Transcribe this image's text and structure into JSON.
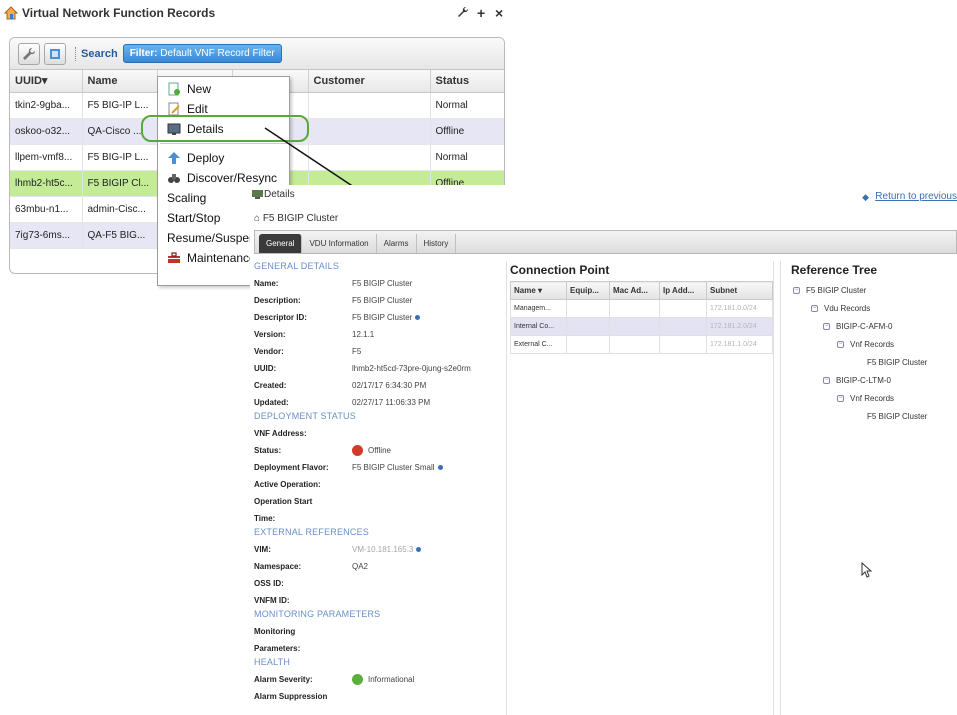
{
  "vnf_window": {
    "title": "Virtual Network Function Records",
    "controls": {
      "wrench": "wrench-icon",
      "plus": "+",
      "close": "×"
    },
    "toolbar": {
      "search_label": "Search",
      "filter_prefix": "Filter:",
      "filter_value": "Default VNF Record Filter"
    },
    "columns": [
      "UUID▾",
      "Name",
      "",
      "",
      "Customer",
      "Status"
    ],
    "rows": [
      {
        "uuid": "tkin2-9gba...",
        "name": "F5 BIG-IP L...",
        "customer": "",
        "status": "Normal"
      },
      {
        "uuid": "oskoo-o32...",
        "name": "QA-Cisco ...",
        "customer": "",
        "status": "Offline"
      },
      {
        "uuid": "llpem-vmf8...",
        "name": "F5 BIG-IP L...",
        "customer": "",
        "status": "Normal"
      },
      {
        "uuid": "lhmb2-ht5c...",
        "name": "F5 BIGIP Cl...",
        "customer": "",
        "status": "Offline"
      },
      {
        "uuid": "63mbu-n1...",
        "name": "admin-Cisc...",
        "customer": "",
        "status": ""
      },
      {
        "uuid": "7ig73-6ms...",
        "name": "QA-F5 BIG...",
        "customer": "",
        "status": ""
      }
    ]
  },
  "context_menu": {
    "items": [
      "New",
      "Edit",
      "Details",
      "Deploy",
      "Discover/Resync",
      "Scaling",
      "Start/Stop",
      "Resume/Suspend",
      "Maintenance"
    ]
  },
  "details": {
    "window_title": "Details",
    "return_link": "Return to previous",
    "subtitle": "F5 BIGIP Cluster",
    "tabs": [
      "General",
      "VDU Information",
      "Alarms",
      "History"
    ],
    "general": {
      "sections": [
        {
          "heading": "GENERAL DETAILS",
          "fields": [
            {
              "k": "Name:",
              "v": "F5 BIGIP Cluster"
            },
            {
              "k": "Description:",
              "v": "F5 BIGIP Cluster"
            },
            {
              "k": "Descriptor ID:",
              "v": "F5 BIGIP Cluster"
            },
            {
              "k": "Version:",
              "v": "12.1.1"
            },
            {
              "k": "Vendor:",
              "v": "F5"
            },
            {
              "k": "UUID:",
              "v": "lhmb2-ht5cd-73pre-0jung-s2e0rm"
            },
            {
              "k": "Created:",
              "v": "02/17/17 6:34:30 PM"
            },
            {
              "k": "Updated:",
              "v": "02/27/17 11:06:33 PM"
            }
          ]
        },
        {
          "heading": "DEPLOYMENT STATUS",
          "fields": [
            {
              "k": "VNF Address:",
              "v": ""
            },
            {
              "k": "Status:",
              "v": "Offline"
            },
            {
              "k": "Deployment Flavor:",
              "v": "F5 BIGIP Cluster Small"
            },
            {
              "k": "Active Operation:",
              "v": ""
            },
            {
              "k": "Operation Start",
              "v": ""
            },
            {
              "k": "Time:",
              "v": ""
            }
          ]
        },
        {
          "heading": "EXTERNAL REFERENCES",
          "fields": [
            {
              "k": "VIM:",
              "v": "VM-10.181.165.3"
            },
            {
              "k": "Namespace:",
              "v": "QA2"
            },
            {
              "k": "OSS ID:",
              "v": ""
            },
            {
              "k": "VNFM ID:",
              "v": ""
            }
          ]
        },
        {
          "heading": "MONITORING PARAMETERS",
          "fields": [
            {
              "k": "Monitoring",
              "v": ""
            },
            {
              "k": "Parameters:",
              "v": ""
            }
          ]
        },
        {
          "heading": "HEALTH",
          "fields": [
            {
              "k": "Alarm Severity:",
              "v": "Informational"
            },
            {
              "k": "Alarm Suppression",
              "v": ""
            }
          ]
        }
      ]
    },
    "connection_point": {
      "title": "Connection Point",
      "columns": [
        "Name ▾",
        "Equip...",
        "Mac Ad...",
        "Ip Add...",
        "Subnet"
      ],
      "rows": [
        [
          "Managem...",
          "",
          "",
          "",
          "172.181.0.0/24"
        ],
        [
          "Internal Co...",
          "",
          "",
          "",
          "172.181.2.0/24"
        ],
        [
          "External C...",
          "",
          "",
          "",
          "172.181.1.0/24"
        ]
      ]
    },
    "reference_tree": {
      "title": "Reference Tree",
      "nodes": [
        "F5 BIGIP Cluster",
        "Vdu Records",
        "BIGIP-C-AFM-0",
        "Vnf Records",
        "F5 BIGIP Cluster",
        "BIGIP-C-LTM-0",
        "Vnf Records",
        "F5 BIGIP Cluster"
      ]
    }
  },
  "colors": {
    "accent": "#3a88d6",
    "selected_row": "#c4ec96",
    "alt_row": "#e6e6f5",
    "highlight_ring": "#5aa83a",
    "section_heading": "#6790c8"
  }
}
